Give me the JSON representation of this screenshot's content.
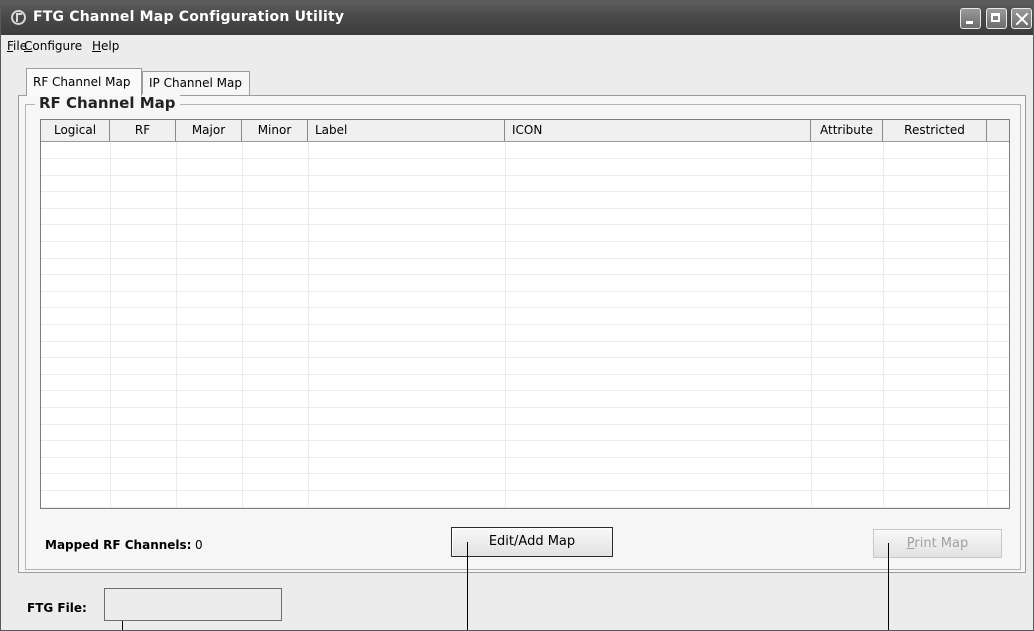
{
  "window": {
    "title": "FTG Channel Map Configuration Utility"
  },
  "menu": {
    "items": [
      "File",
      "Configure",
      "Help"
    ]
  },
  "tabs": [
    {
      "label": "RF Channel Map",
      "active": true
    },
    {
      "label": "IP Channel Map",
      "active": false
    }
  ],
  "group": {
    "title": "RF Channel Map"
  },
  "table": {
    "columns": [
      "Logical",
      "RF",
      "Major",
      "Minor",
      "Label",
      "ICON",
      "Attribute",
      "Restricted"
    ],
    "rows": []
  },
  "status": {
    "mapped_label": "Mapped RF Channels:",
    "mapped_value": "0"
  },
  "buttons": {
    "edit_add": "Edit/Add Map",
    "print": "Print Map",
    "print_enabled": false
  },
  "ftg_file": {
    "label": "FTG File:",
    "value": ""
  }
}
